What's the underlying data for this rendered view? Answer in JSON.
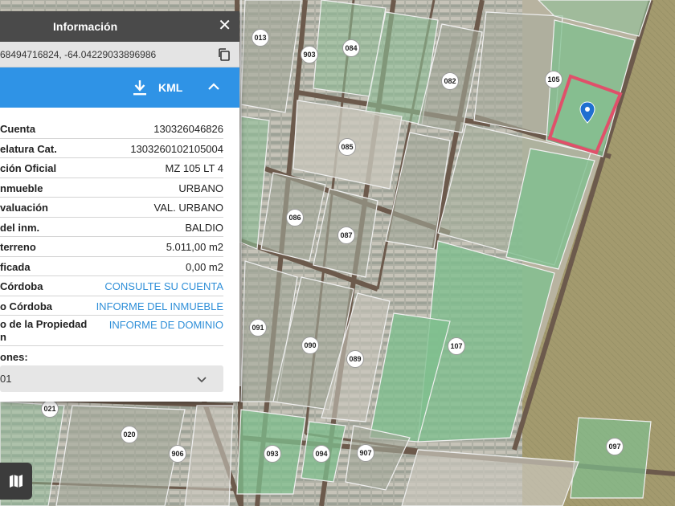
{
  "panel": {
    "title": "Información",
    "coordinates": "68494716824, -64.04229033896986",
    "kml_label": "KML",
    "rows": [
      {
        "label": "Cuenta",
        "value": "130326046826",
        "link": false
      },
      {
        "label": "elatura Cat.",
        "value": "1303260102105004",
        "link": false
      },
      {
        "label": "ción Oficial",
        "value": "MZ 105 LT 4",
        "link": false
      },
      {
        "label": "nmueble",
        "value": "URBANO",
        "link": false
      },
      {
        "label": "valuación",
        "value": "VAL. URBANO",
        "link": false
      },
      {
        "label": "del inm.",
        "value": "BALDIO",
        "link": false
      },
      {
        "label": " terreno",
        "value": "5.011,00 m2",
        "link": false
      },
      {
        "label": "ficada",
        "value": "0,00 m2",
        "link": false
      },
      {
        "label": "Córdoba",
        "value": "CONSULTE SU CUENTA",
        "link": true
      },
      {
        "label": "o Córdoba",
        "value": "INFORME DEL INMUEBLE",
        "link": true
      },
      {
        "label": "o de la Propiedad\nn",
        "value": "INFORME DE DOMINIO",
        "link": true,
        "tall": true
      }
    ],
    "opciones_label": "ones:",
    "opciones_value": "01"
  },
  "map": {
    "colors": {
      "highlight": "#e0506a",
      "marker": "#1f6fd0",
      "parcel_green": "#7fbf8e"
    },
    "lot_labels": [
      "013",
      "903",
      "084",
      "082",
      "105",
      "085",
      "086",
      "087",
      "091",
      "090",
      "089",
      "107",
      "021",
      "020",
      "906",
      "093",
      "094",
      "907",
      "097"
    ]
  },
  "icons": {
    "close": "close-icon",
    "copy": "copy-icon",
    "download": "download-icon",
    "chevron_up": "chevron-up-icon",
    "chevron_down": "chevron-down-icon",
    "layers": "map-layers-icon",
    "marker": "map-pin-icon"
  }
}
